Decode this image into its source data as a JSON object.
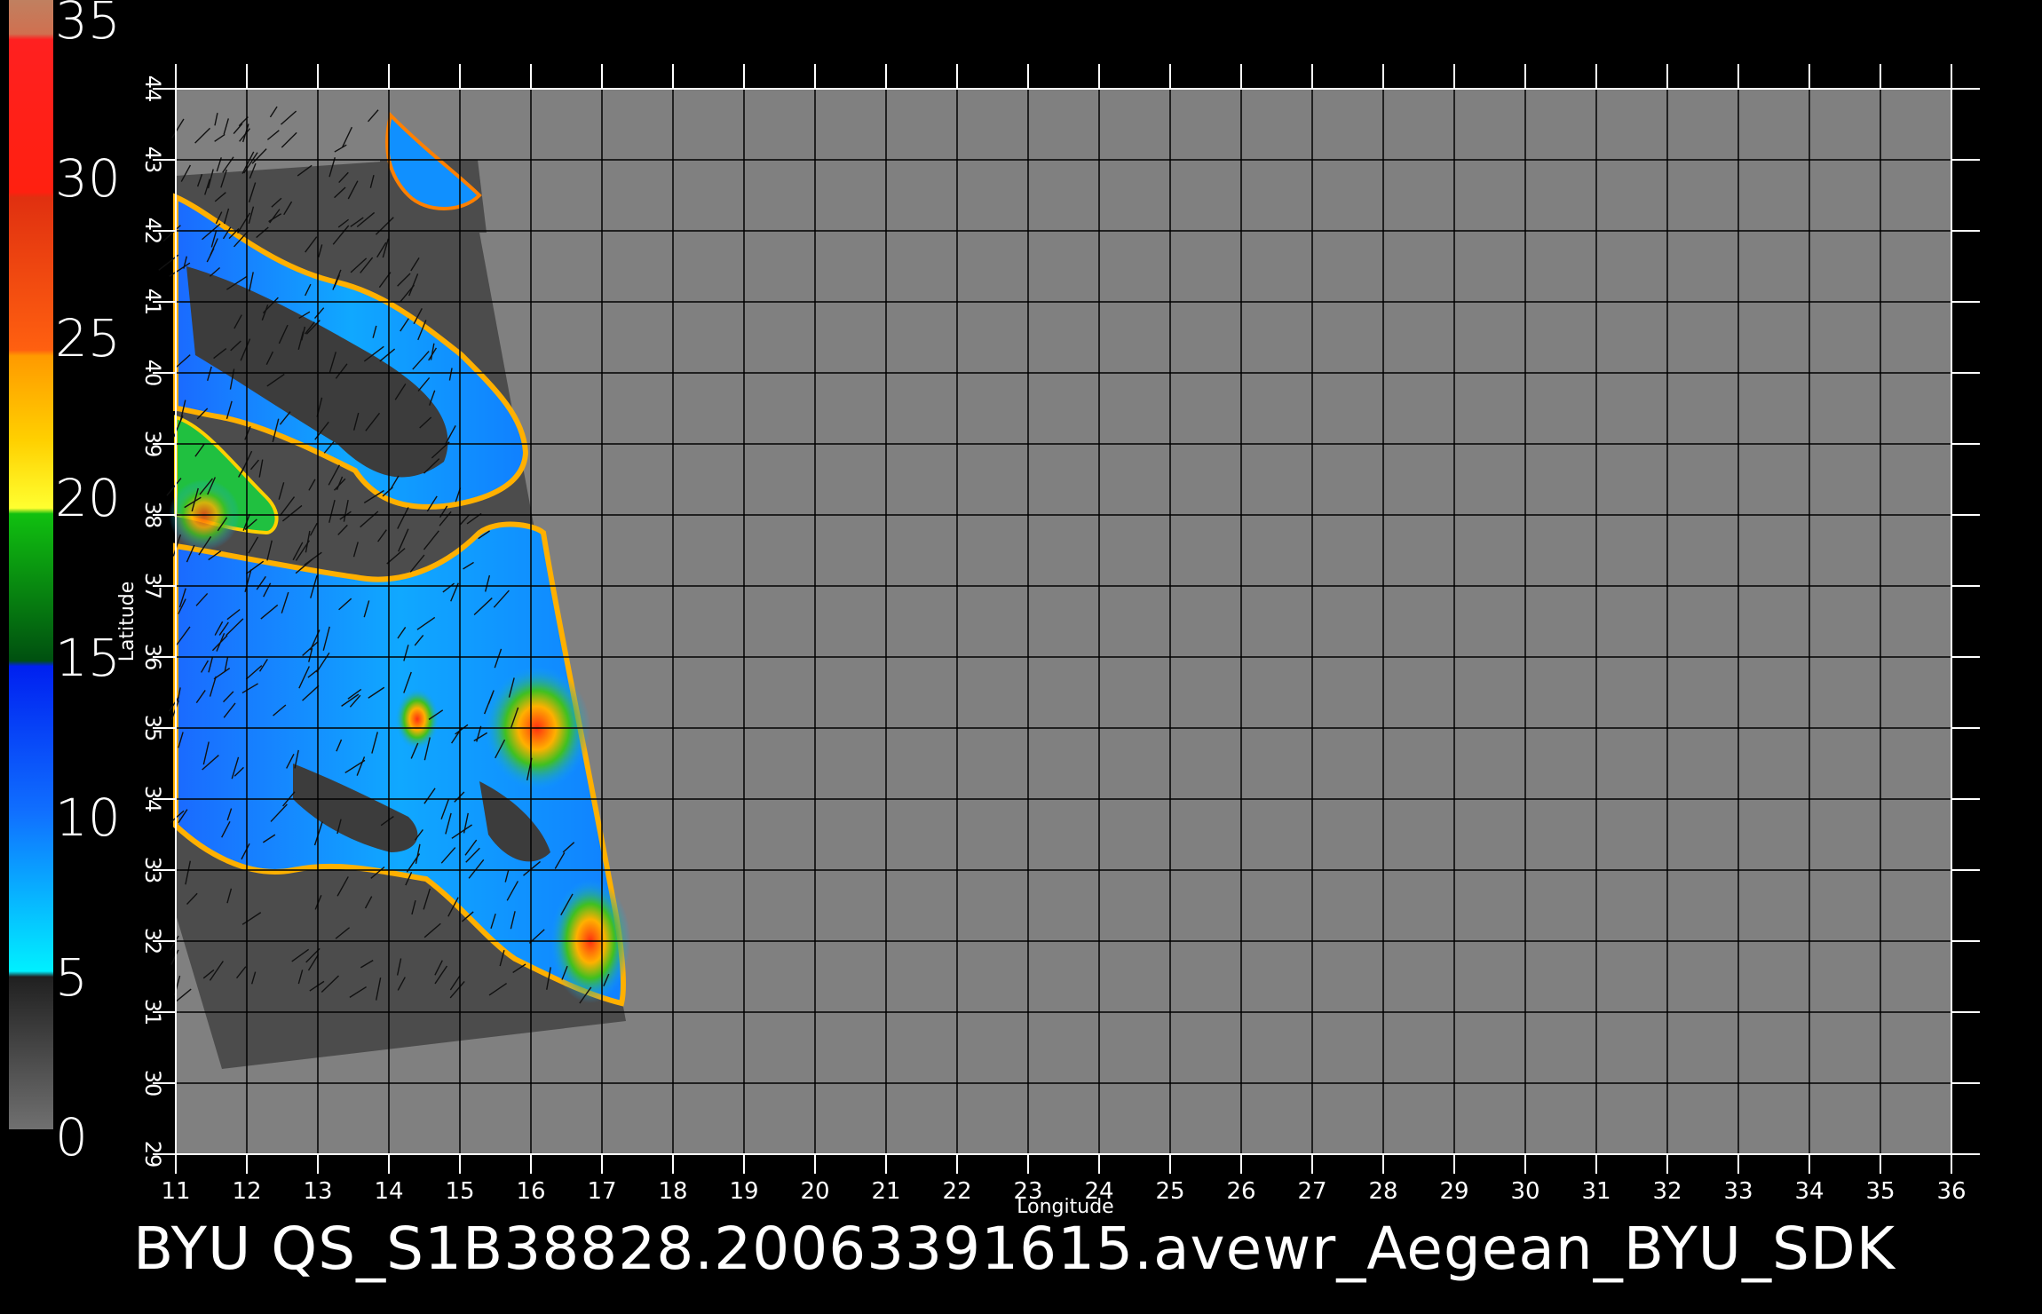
{
  "title": "BYU  QS_S1B38828.20063391615.avewr_Aegean_BYU_SDK",
  "colorbar": {
    "labels": [
      "35",
      "30",
      "25",
      "20",
      "15",
      "10",
      "5",
      "0"
    ],
    "stops": [
      "#c08060",
      "#ff2010",
      "#ff5010",
      "#ff9000",
      "#ffd000",
      "#ffff30",
      "#10c010",
      "#006010",
      "#0030ff",
      "#1070ff",
      "#10a0ff",
      "#00f0ff",
      "#303030",
      "#707070"
    ]
  },
  "map": {
    "xlabel": "Longitude",
    "ylabel": "Latitude",
    "lon_ticks": [
      "11",
      "12",
      "13",
      "14",
      "15",
      "16",
      "17",
      "18",
      "19",
      "20",
      "21",
      "22",
      "23",
      "24",
      "25",
      "26",
      "27",
      "28",
      "29",
      "30",
      "31",
      "32",
      "33",
      "34",
      "35",
      "36"
    ],
    "lat_ticks": [
      "29",
      "30",
      "31",
      "32",
      "33",
      "34",
      "35",
      "36",
      "37",
      "38",
      "39",
      "40",
      "41",
      "42",
      "43",
      "44"
    ],
    "background_color": "#808080",
    "land_color": "#4a4a4a",
    "grid_color": "#000000"
  }
}
